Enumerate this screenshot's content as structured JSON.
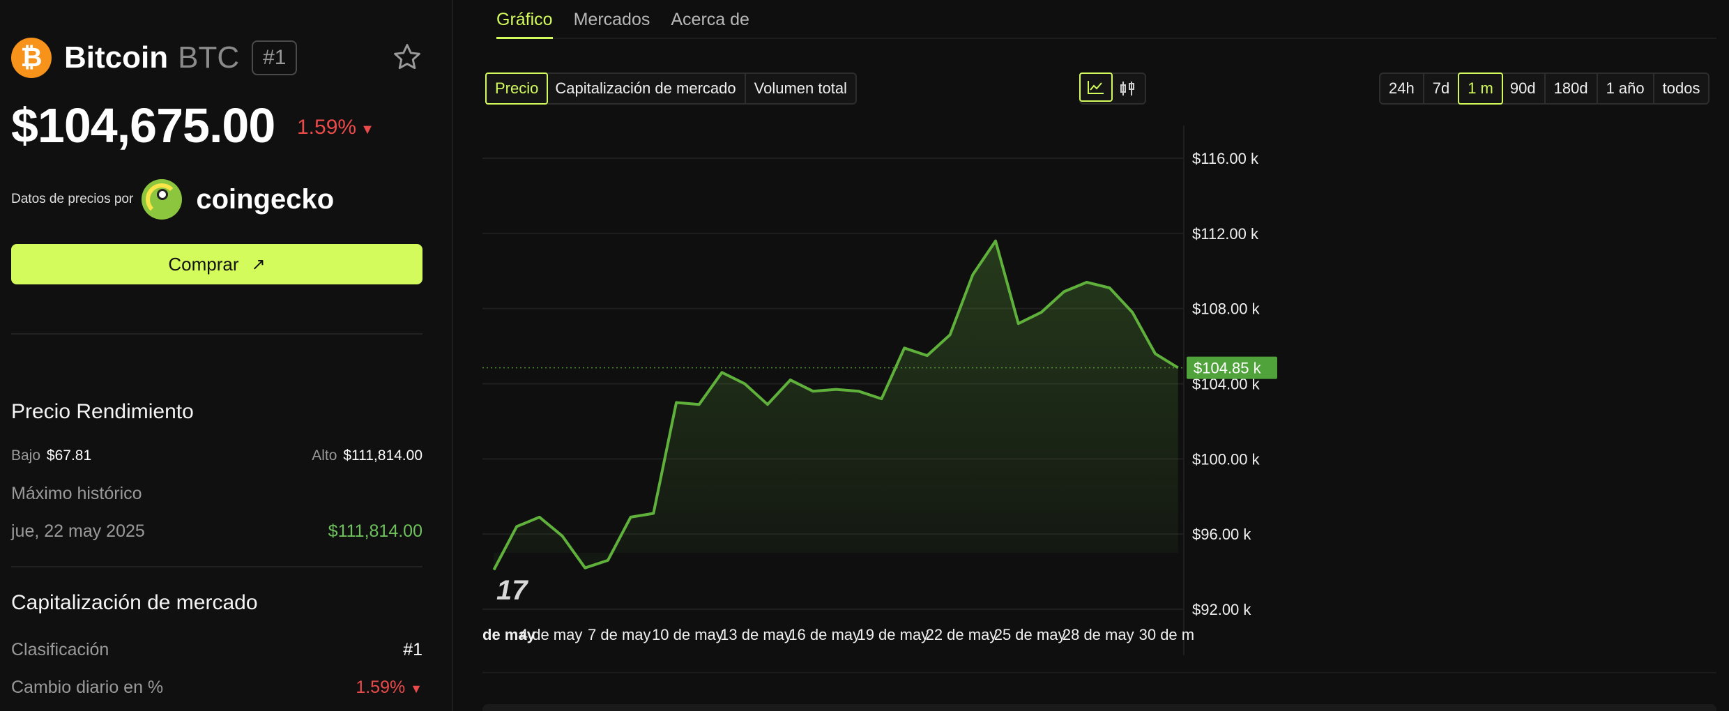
{
  "coin": {
    "logo_glyph": "₿",
    "name": "Bitcoin",
    "symbol": "BTC",
    "rank": "#1",
    "price": "$104,675.00",
    "change": "1.59%",
    "change_arrow": "▼"
  },
  "source": {
    "label": "Datos de precios por",
    "brand": "coingecko"
  },
  "buy": {
    "label": "Comprar",
    "arrow": "↗"
  },
  "performance": {
    "title": "Precio Rendimiento",
    "low_label": "Bajo",
    "low_value": "$67.81",
    "high_label": "Alto",
    "high_value": "$111,814.00",
    "ath_label": "Máximo histórico",
    "ath_date": "jue, 22 may 2025",
    "ath_value": "$111,814.00"
  },
  "market_cap": {
    "title": "Capitalización de mercado",
    "rank_label": "Clasificación",
    "rank_value": "#1",
    "daily_label": "Cambio diario en %",
    "daily_value": "1.59%",
    "daily_arrow": "▼"
  },
  "tabs": [
    {
      "label": "Gráfico",
      "active": true
    },
    {
      "label": "Mercados",
      "active": false
    },
    {
      "label": "Acerca de",
      "active": false
    }
  ],
  "metric_buttons": [
    {
      "label": "Precio",
      "active": true
    },
    {
      "label": "Capitalización de mercado",
      "active": false
    },
    {
      "label": "Volumen total",
      "active": false
    }
  ],
  "chart_modes": [
    {
      "icon": "line-chart-icon",
      "active": true
    },
    {
      "icon": "candlestick-icon",
      "active": false
    }
  ],
  "ranges": [
    {
      "label": "24h",
      "active": false
    },
    {
      "label": "7d",
      "active": false
    },
    {
      "label": "1 m",
      "active": true
    },
    {
      "label": "90d",
      "active": false
    },
    {
      "label": "180d",
      "active": false
    },
    {
      "label": "1 año",
      "active": false
    },
    {
      "label": "todos",
      "active": false
    }
  ],
  "colors": {
    "accent": "#d4fb5c",
    "up": "#6ec15c",
    "down": "#ea4a4a",
    "line": "#5fb13c"
  },
  "chart_data": {
    "type": "area",
    "x_tick_labels": [
      "de may",
      "4 de may",
      "7 de may",
      "10 de may",
      "13 de may",
      "16 de may",
      "19 de may",
      "22 de may",
      "25 de may",
      "28 de may",
      "30 de m"
    ],
    "y_tick_labels": [
      "$116.00 k",
      "$112.00 k",
      "$108.00 k",
      "$104.00 k",
      "$100.00 k",
      "$96.00 k",
      "$92.00 k"
    ],
    "ylim": [
      92,
      116
    ],
    "y_ticks": [
      116,
      112,
      108,
      104,
      100,
      96,
      92
    ],
    "x_day_range": [
      1,
      31.6
    ],
    "x_tick_days": [
      1,
      4,
      7,
      10,
      13,
      16,
      19,
      22,
      25,
      28,
      31
    ],
    "current_value": 104.85,
    "current_label": "$104.85 k",
    "series": [
      {
        "points": [
          [
            1.5,
            94.1
          ],
          [
            2.5,
            96.4
          ],
          [
            3.5,
            96.9
          ],
          [
            4.5,
            95.9
          ],
          [
            5.5,
            94.2
          ],
          [
            6.5,
            94.6
          ],
          [
            7.5,
            96.9
          ],
          [
            8.5,
            97.1
          ],
          [
            9.5,
            103.0
          ],
          [
            10.5,
            102.9
          ],
          [
            11.5,
            104.6
          ],
          [
            12.5,
            104.0
          ],
          [
            13.5,
            102.9
          ],
          [
            14.5,
            104.2
          ],
          [
            15.5,
            103.6
          ],
          [
            16.5,
            103.7
          ],
          [
            17.5,
            103.6
          ],
          [
            18.5,
            103.2
          ],
          [
            19.5,
            105.9
          ],
          [
            20.5,
            105.5
          ],
          [
            21.5,
            106.6
          ],
          [
            22.5,
            109.8
          ],
          [
            23.5,
            111.6
          ],
          [
            24.5,
            107.2
          ],
          [
            25.5,
            107.8
          ],
          [
            26.5,
            108.9
          ],
          [
            27.5,
            109.4
          ],
          [
            28.5,
            109.1
          ],
          [
            29.5,
            107.8
          ],
          [
            30.5,
            105.6
          ],
          [
            31.5,
            104.85
          ]
        ]
      }
    ]
  }
}
